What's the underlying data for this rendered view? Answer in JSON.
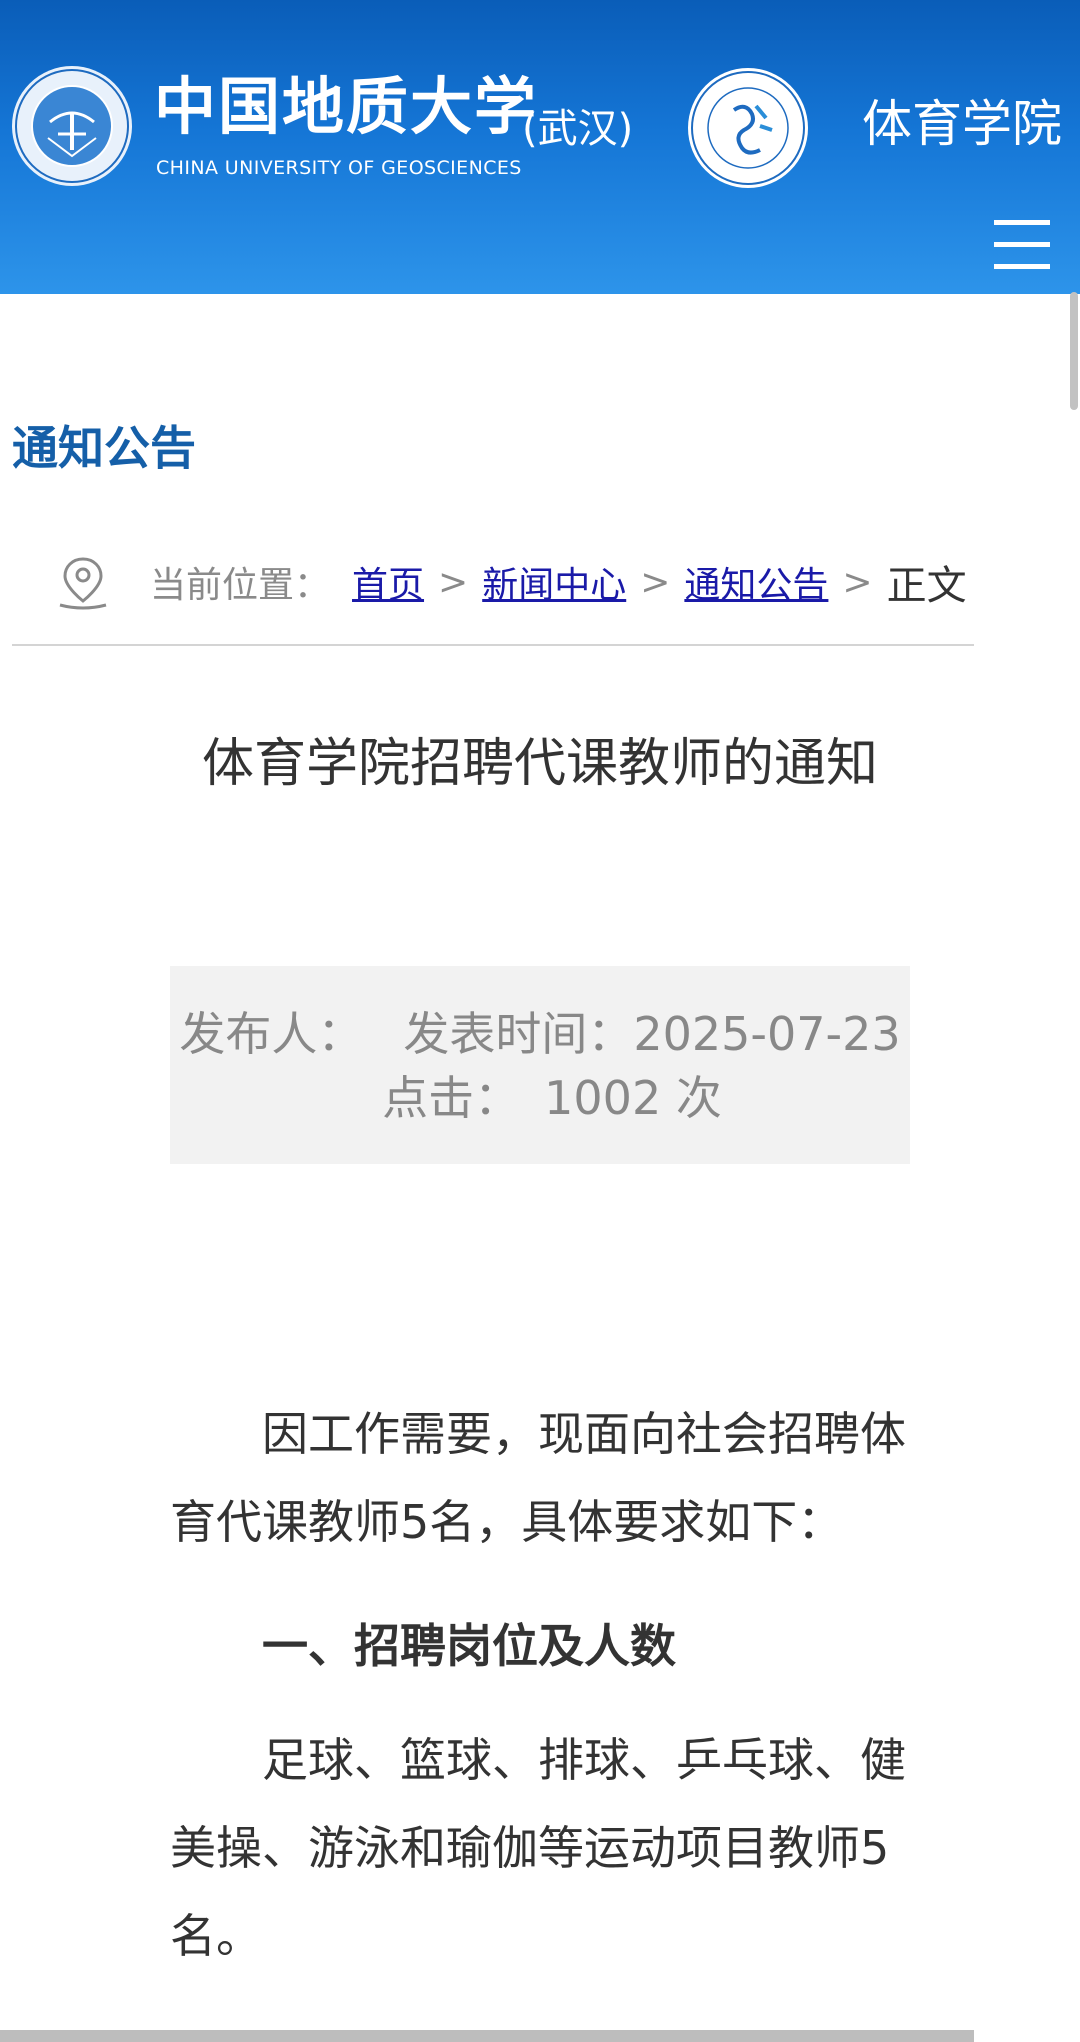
{
  "header": {
    "university_name_cn": "中国地质大学",
    "university_city": "(武汉)",
    "university_name_en": "CHINA UNIVERSITY OF GEOSCIENCES",
    "college_name": "体育学院",
    "background_color": "#1576d6"
  },
  "section": {
    "title": "通知公告",
    "title_color": "#155fa8"
  },
  "breadcrumb": {
    "label": "当前位置：",
    "items": [
      "首页",
      "新闻中心",
      "通知公告"
    ],
    "separator": ">",
    "current": "正文",
    "link_color": "#1a1aa8"
  },
  "article": {
    "title": "体育学院招聘代课教师的通知",
    "meta": {
      "publisher_label": "发布人：",
      "time_label": "发表时间：",
      "time_value": "2025-07-23",
      "clicks_label": "点击：",
      "clicks_value": "1002 次"
    },
    "paragraph_1": "因工作需要，现面向社会招聘体育代课教师5名，具体要求如下：",
    "heading_1": "一、招聘岗位及人数",
    "paragraph_2": "足球、篮球、排球、乒乓球、健美操、游泳和瑜伽等运动项目教师5名。"
  }
}
